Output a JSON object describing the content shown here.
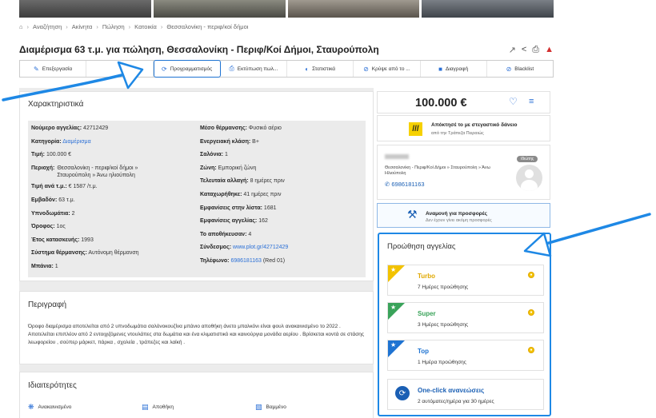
{
  "breadcrumb": {
    "home_icon": "home-icon",
    "items": [
      "Αναζήτηση",
      "Ακίνητα",
      "Πώληση",
      "Κατοικία",
      "Θεσσαλονίκη - περιφ/κοί δήμοι"
    ]
  },
  "title": "Διαμέρισμα 63 τ.μ. για πώληση, Θεσσαλονίκη - Περιφ/Κοί Δήμοι, Σταυρούπολη",
  "title_icons": [
    "wrench-icon",
    "share-icon",
    "print-icon",
    "warning-icon"
  ],
  "toolbar": [
    {
      "label": "Επεξεργασία",
      "icon": "edit-icon"
    },
    {
      "label": "",
      "icon": ""
    },
    {
      "label": "Προγραμματισμός",
      "icon": "schedule-icon",
      "active": true
    },
    {
      "label": "Εκτύπωση πωλ...",
      "icon": "print-icon"
    },
    {
      "label": "Στατιστικά",
      "icon": "stats-icon"
    },
    {
      "label": "Κρύψε από το ...",
      "icon": "hide-icon"
    },
    {
      "label": "Διαγραφή",
      "icon": "trash-icon"
    },
    {
      "label": "Blacklist",
      "icon": "block-icon"
    }
  ],
  "features": {
    "title": "Χαρακτηριστικά",
    "left": [
      {
        "k": "Νούμερο αγγελίας:",
        "v": "42712429"
      },
      {
        "k": "Κατηγορία:",
        "v": "Διαμέρισμα",
        "link": true
      },
      {
        "k": "Τιμή:",
        "v": "100.000 €"
      },
      {
        "k": "Περιοχή:",
        "v": "Θεσσαλονίκη - περιφ/κοί δήμοι » Σταυρούπολη » Άνω ηλιούπολη",
        "two": true
      },
      {
        "k": "Τιμή ανά τ.μ.:",
        "v": "€ 1587 /τ.μ."
      },
      {
        "k": "Εμβαδόν:",
        "v": "63 τ.μ."
      },
      {
        "k": "Υπνοδωμάτια:",
        "v": "2"
      },
      {
        "k": "Όροφος:",
        "v": "1ος"
      },
      {
        "k": "Έτος κατασκευής:",
        "v": "1993"
      },
      {
        "k": "Σύστημα θέρμανσης:",
        "v": "Αυτόνομη θέρμανση"
      },
      {
        "k": "Μπάνια:",
        "v": "1"
      }
    ],
    "right": [
      {
        "k": "Μέσο θέρμανσης:",
        "v": "Φυσικό αέριο"
      },
      {
        "k": "Ενεργειακή κλάση:",
        "v": "B+"
      },
      {
        "k": "Σαλόνια:",
        "v": "1"
      },
      {
        "k": "Ζώνη:",
        "v": "Εμπορική ζώνη"
      },
      {
        "k": "Τελευταία αλλαγή:",
        "v": "8 ημέρες πριν"
      },
      {
        "k": "Καταχωρήθηκε:",
        "v": "41 ημέρες πριν"
      },
      {
        "k": "Εμφανίσεις στην λίστα:",
        "v": "1681"
      },
      {
        "k": "Εμφανίσεις αγγελίας:",
        "v": "162"
      },
      {
        "k": "Το αποθήκευσαν:",
        "v": "4"
      },
      {
        "k": "Σύνδεσμος:",
        "v": "www.plot.gr/42712429",
        "link": true
      },
      {
        "k": "Τηλέφωνο:",
        "v": "6986181163",
        "link": true,
        "extra": "(Red 01)"
      }
    ]
  },
  "description": {
    "title": "Περιγραφή",
    "text": "Όροφο διαμέρισμα αποτελείται από 2 υπνοδωμάτια σαλόνοκουζίνα μπάνιο αποθήκη άνετο μπαλκόνι  είναι φουλ ανακαινισμένο το 2022 . Αποτελείται επιπλέον από 2 εντοιχιζόμενες ντουλάπες στα δωμάτια και ένα κλιματιστικό και καινούργια μονάδα αερίου . Βρίσκεται κοντά σε στάσης λεωφορείου , σούπερ μάρκετ, πάρκα , σχολεία , τράπεζες και λαϊκή ."
  },
  "properties": {
    "title": "Ιδιαιτερότητες",
    "items": [
      {
        "label": "Ανακαινισμένο",
        "icon": "renovated-icon"
      },
      {
        "label": "Αποθήκη",
        "icon": "storage-icon"
      },
      {
        "label": "Βαμμένο",
        "icon": "paint-roller-icon"
      }
    ]
  },
  "price": {
    "value": "100.000 €",
    "icons": [
      "heart-icon",
      "compare-icon"
    ]
  },
  "loan": {
    "title": "Απόκτησέ το με στεγαστικό δάνειο",
    "subtitle": "από την Τράπεζα Πειραιώς",
    "logo": "///"
  },
  "seller": {
    "address": "Θεσσαλονίκη - Περιφ/Κοί Δήμοι » Σταυρούπολη » Άνω Ηλιούπολη",
    "phone": "6986181163",
    "badge": "Ιδιώτης"
  },
  "offers": {
    "title": "Αναμονή για προσφορές",
    "subtitle": "Δεν έχουν γίνει ακόμη προσφορές"
  },
  "promotion": {
    "title": "Προώθηση αγγελίας",
    "cards": [
      {
        "name": "Turbo",
        "sub": "7 Ημέρες προώθησης",
        "color": "#f2c200"
      },
      {
        "name": "Super",
        "sub": "3 Ημέρες προώθησης",
        "color": "#3aa35a"
      },
      {
        "name": "Top",
        "sub": "1 Ημέρα προώθησης",
        "color": "#1e73d2"
      },
      {
        "name": "One-click ανανεώσεις",
        "sub": "2 αυτόματες/ημέρα για 30 ημέρες",
        "color": "#1a5fb4"
      }
    ]
  },
  "colors": {
    "accent": "#1e73d2",
    "annotation_arrow": "#1e88e5"
  }
}
